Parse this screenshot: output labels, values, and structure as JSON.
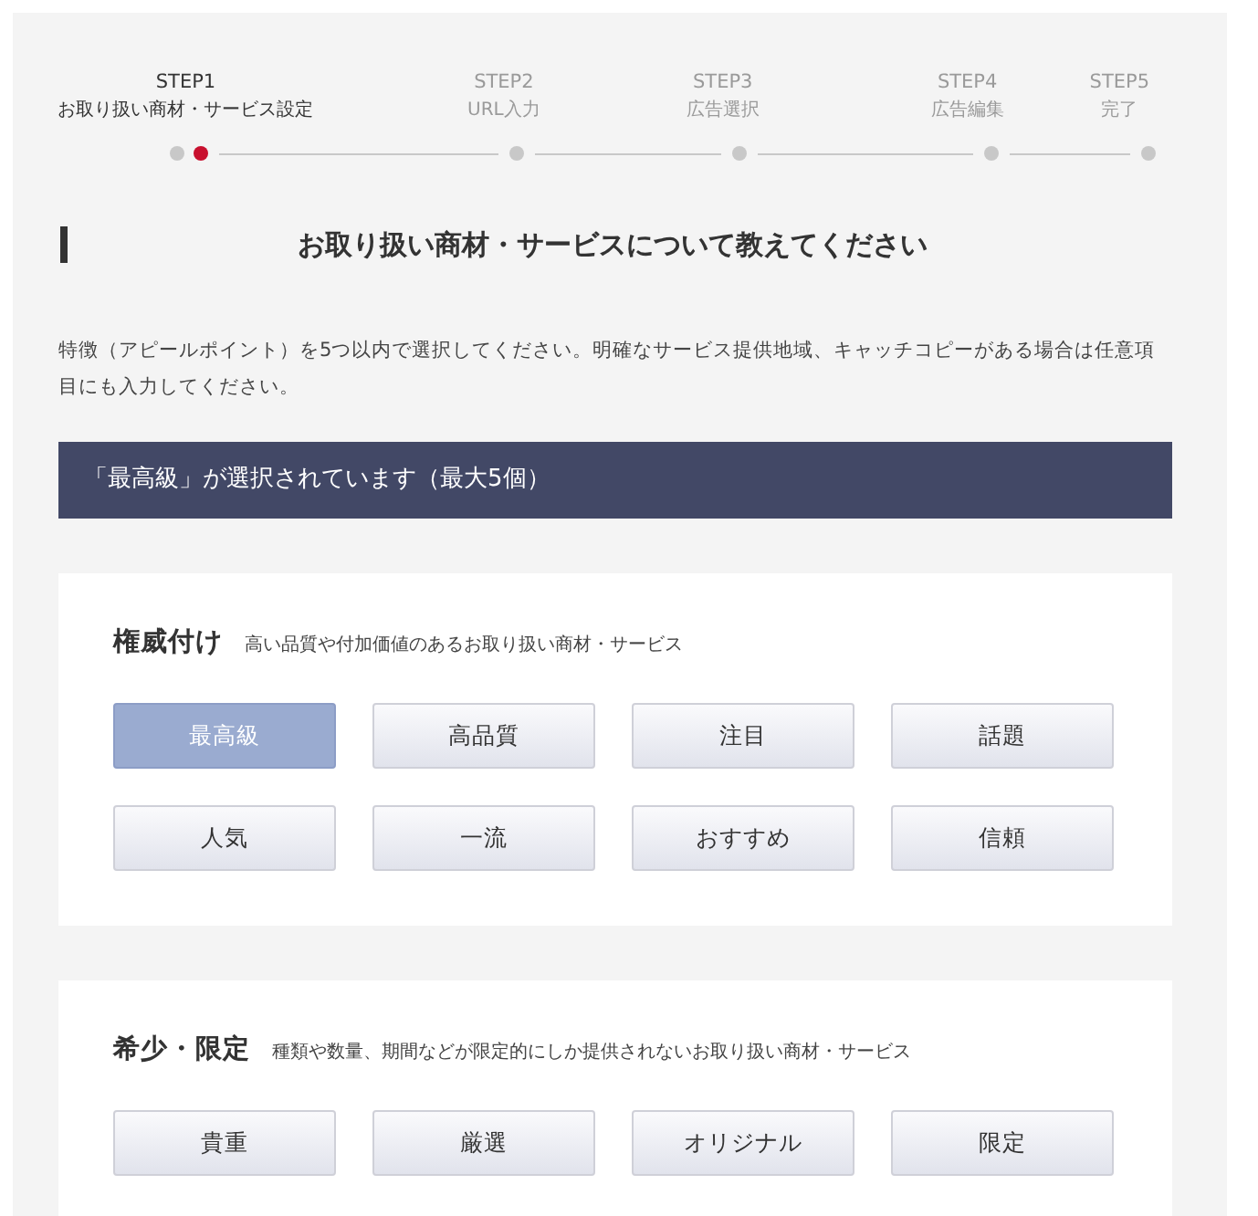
{
  "steps": [
    {
      "label": "STEP1",
      "name": "お取り扱い商材・サービス設定",
      "selected": true
    },
    {
      "label": "STEP2",
      "name": "URL入力",
      "selected": false
    },
    {
      "label": "STEP3",
      "name": "広告選択",
      "selected": false
    },
    {
      "label": "STEP4",
      "name": "広告編集",
      "selected": false
    },
    {
      "label": "STEP5",
      "name": "完了",
      "selected": false
    }
  ],
  "heading": "お取り扱い商材・サービスについて教えてください",
  "description": "特徴（アピールポイント）を5つ以内で選択してください。明確なサービス提供地域、キャッチコピーがある場合は任意項目にも入力してください。",
  "selection_banner": "「最高級」が選択されています（最大5個）",
  "sections": [
    {
      "title": "権威付け",
      "subtitle": "高い品質や付加価値のあるお取り扱い商材・サービス",
      "options": [
        {
          "label": "最高級",
          "selected": true
        },
        {
          "label": "高品質",
          "selected": false
        },
        {
          "label": "注目",
          "selected": false
        },
        {
          "label": "話題",
          "selected": false
        },
        {
          "label": "人気",
          "selected": false
        },
        {
          "label": "一流",
          "selected": false
        },
        {
          "label": "おすすめ",
          "selected": false
        },
        {
          "label": "信頼",
          "selected": false
        }
      ]
    },
    {
      "title": "希少・限定",
      "subtitle": "種類や数量、期間などが限定的にしか提供されないお取り扱い商材・サービス",
      "options": [
        {
          "label": "貴重",
          "selected": false
        },
        {
          "label": "厳選",
          "selected": false
        },
        {
          "label": "オリジナル",
          "selected": false
        },
        {
          "label": "限定",
          "selected": false
        }
      ]
    }
  ]
}
